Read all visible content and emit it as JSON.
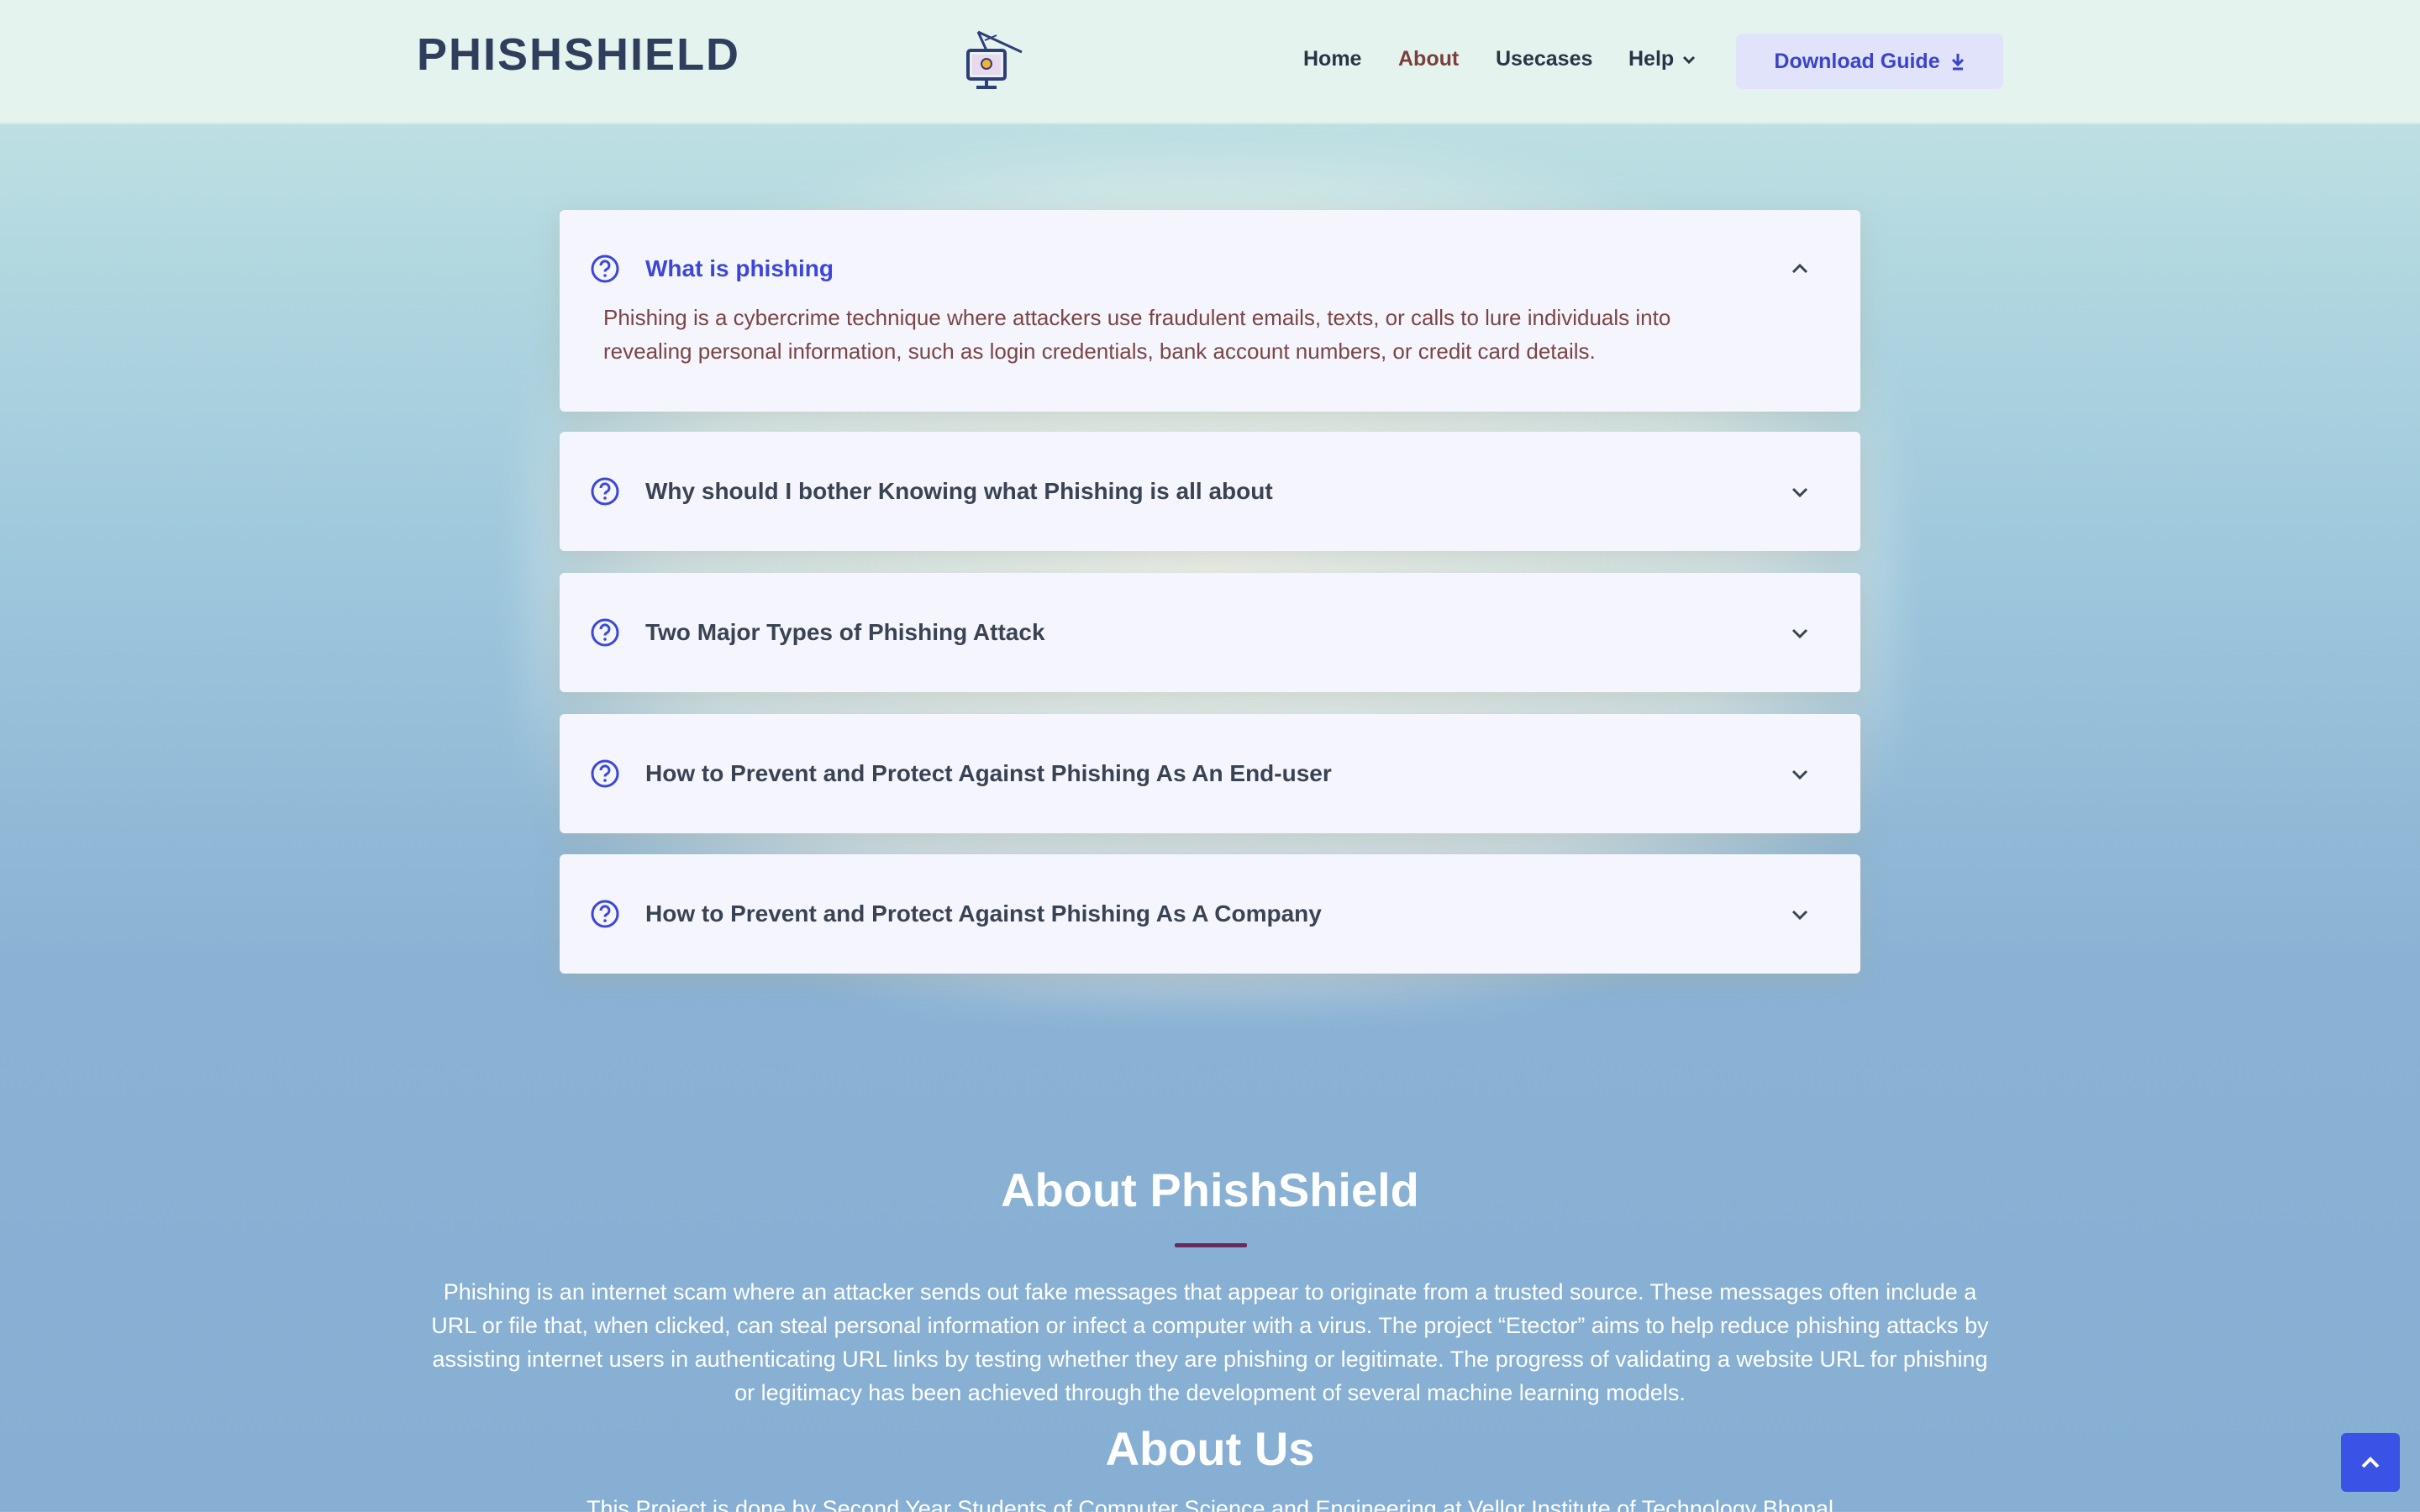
{
  "header": {
    "brand": "PHISHSHIELD",
    "logo_icon": "computer-satellite-icon",
    "nav": [
      {
        "label": "Home",
        "active": false
      },
      {
        "label": "About",
        "active": true
      },
      {
        "label": "Usecases",
        "active": false
      },
      {
        "label": "Help",
        "active": false,
        "has_dropdown": true
      }
    ],
    "download_label": "Download Guide",
    "download_icon": "download-arrow-icon"
  },
  "faq": [
    {
      "question": "What is phishing",
      "open": true,
      "answer_line1": "Phishing is a cybercrime technique where attackers use fraudulent emails, texts, or calls to lure individuals into",
      "answer_line2": "revealing personal information, such as login credentials, bank account numbers, or credit card details."
    },
    {
      "question": "Why should I bother Knowing what Phishing is all about",
      "open": false
    },
    {
      "question": "Two Major Types of Phishing Attack",
      "open": false
    },
    {
      "question": "How to Prevent and Protect Against Phishing As An End-user",
      "open": false
    },
    {
      "question": "How to Prevent and Protect Against Phishing As A Company",
      "open": false
    }
  ],
  "about": {
    "title": "About PhishShield",
    "text_lines": [
      "Phishing is an internet scam where an attacker sends out fake messages that appear to originate from a trusted source. These messages often include a",
      "URL or file that, when clicked, can steal personal information or infect a computer with a virus. The project “Etector” aims to help reduce phishing attacks by",
      "assisting internet users in authenticating URL links by testing whether they are phishing or legitimate. The progress of validating a website URL for phishing",
      "or legitimacy has been achieved through the development of several machine learning models."
    ],
    "about_us_title": "About Us",
    "about_us_text": "This Project is done by Second Year Students of Computer Science and Engineering at Vellor Institute of Technology Bhopal"
  },
  "colors": {
    "accent": "#3c47d8",
    "brand": "#2f3e5c",
    "active_nav": "#7a3f3a",
    "scroll_top": "#3a53e6"
  }
}
